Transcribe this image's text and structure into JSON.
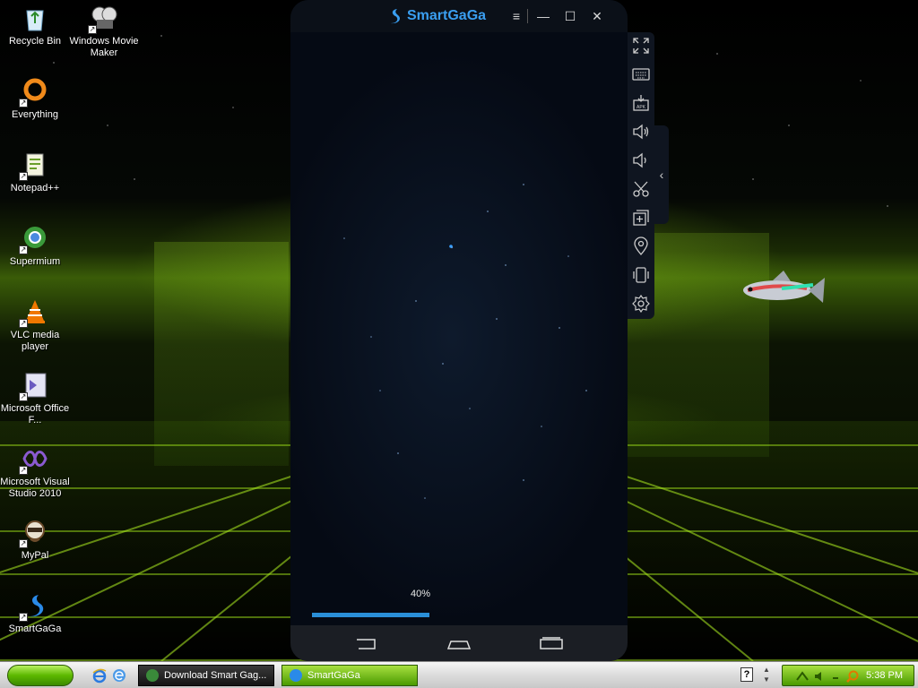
{
  "desktop": {
    "icons": [
      {
        "label": "Recycle Bin",
        "icon": "recycle-bin-icon"
      },
      {
        "label": "Windows Movie Maker",
        "icon": "movie-maker-icon"
      },
      {
        "label": "Everything",
        "icon": "everything-icon"
      },
      {
        "label": "Notepad++",
        "icon": "notepad-plus-plus-icon"
      },
      {
        "label": "Supermium",
        "icon": "supermium-icon"
      },
      {
        "label": "VLC media player",
        "icon": "vlc-icon"
      },
      {
        "label": "Microsoft Office F...",
        "icon": "office-icon"
      },
      {
        "label": "Microsoft Visual Studio 2010",
        "icon": "visual-studio-icon"
      },
      {
        "label": "MyPal",
        "icon": "mypal-icon"
      },
      {
        "label": "SmartGaGa",
        "icon": "smartgaga-icon"
      }
    ]
  },
  "emulator": {
    "brand": "SmartGaGa",
    "brand_color": "#3a9ef0",
    "window_controls": {
      "menu": "≡",
      "minimize": "—",
      "maximize": "☐",
      "close": "✕"
    },
    "loading": {
      "progress_text": "40%",
      "progress_fraction": 0.4,
      "progress_color": "#2a8fd8"
    },
    "toolbar": [
      "fullscreen-icon",
      "keyboard-icon",
      "apk-install-icon",
      "volume-up-icon",
      "volume-down-icon",
      "screenshot-scissors-icon",
      "multi-instance-icon",
      "location-icon",
      "shake-icon",
      "settings-icon"
    ],
    "nav": [
      "back-icon",
      "home-icon",
      "recents-icon"
    ]
  },
  "taskbar": {
    "tasks": [
      {
        "label": "Download Smart Gag..."
      },
      {
        "label": "SmartGaGa"
      }
    ],
    "help_glyph": "?",
    "clock": "5:38 PM"
  }
}
